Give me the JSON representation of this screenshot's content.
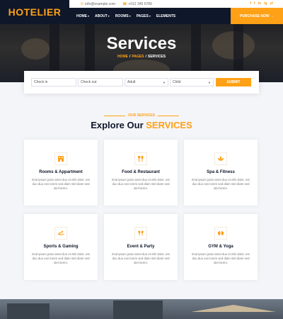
{
  "brand": {
    "logo": "HOTELIER"
  },
  "topbar": {
    "email": "info@example.com",
    "phone": "+012 345 6789",
    "socials": [
      "f",
      "t",
      "in",
      "ig",
      "yt"
    ]
  },
  "nav": {
    "items": [
      {
        "label": "HOME",
        "dropdown": true
      },
      {
        "label": "ABOUT",
        "dropdown": true
      },
      {
        "label": "ROOMS",
        "dropdown": true
      },
      {
        "label": "PAGES",
        "dropdown": true
      },
      {
        "label": "ELEMENTS",
        "dropdown": false
      }
    ],
    "purchase": "PURCHASE NOW →"
  },
  "hero": {
    "title": "Services",
    "breadcrumb": [
      "HOME",
      "PAGES",
      "SERVICES"
    ]
  },
  "booking": {
    "checkin_placeholder": "Check in",
    "checkout_placeholder": "Check out",
    "adult": "Adult",
    "child": "Child",
    "submit": "SUBMIT"
  },
  "section": {
    "subtitle": "OUR SERVICES",
    "title_prefix": "Explore Our",
    "title_accent": "SERVICES"
  },
  "services": [
    {
      "title": "Rooms & Appartment",
      "icon": "hotel-icon",
      "text": "Erat ipsum justo amet duo et elitr dolor, est duo duo eos lorem sed diam stet diam sed stet lorem."
    },
    {
      "title": "Food & Restaurant",
      "icon": "utensils-icon",
      "text": "Erat ipsum justo amet duo et elitr dolor, est duo duo eos lorem sed diam stet diam sed stet lorem."
    },
    {
      "title": "Spa & Fitness",
      "icon": "spa-icon",
      "text": "Erat ipsum justo amet duo et elitr dolor, est duo duo eos lorem sed diam stet diam sed stet lorem."
    },
    {
      "title": "Sports & Gaming",
      "icon": "swimmer-icon",
      "text": "Erat ipsum justo amet duo et elitr dolor, est duo duo eos lorem sed diam stet diam sed stet lorem."
    },
    {
      "title": "Event & Party",
      "icon": "glass-cheers-icon",
      "text": "Erat ipsum justo amet duo et elitr dolor, est duo duo eos lorem sed diam stet diam sed stet lorem."
    },
    {
      "title": "GYM & Yoga",
      "icon": "dumbbell-icon",
      "text": "Erat ipsum justo amet duo et elitr dolor, est duo duo eos lorem sed diam stet diam sed stet lorem."
    }
  ],
  "colors": {
    "primary": "#fea116",
    "dark": "#0f172b"
  }
}
